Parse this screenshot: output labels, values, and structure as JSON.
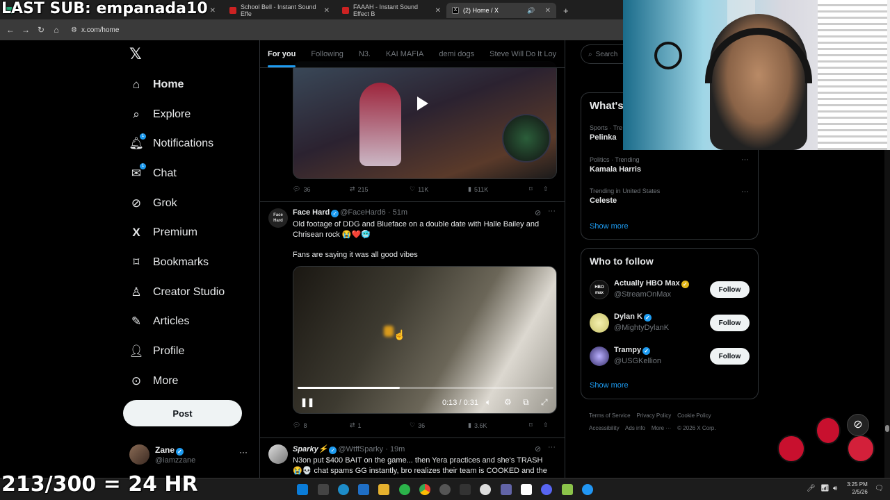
{
  "browser": {
    "tabs": [
      {
        "label": "",
        "active": false
      },
      {
        "label": "School Bell - Instant Sound Effe",
        "active": false
      },
      {
        "label": "FAAAH - Instant Sound Effect B",
        "active": false
      },
      {
        "label": "(2) Home / X",
        "active": true
      }
    ],
    "url": "x.com/home"
  },
  "overlay": {
    "top_banner": "LAST SUB: empanada10",
    "bottom_banner": "213/300 = 24 HR"
  },
  "sidebar": {
    "items": [
      {
        "label": "Home",
        "icon": "home-icon"
      },
      {
        "label": "Explore",
        "icon": "search-icon"
      },
      {
        "label": "Notifications",
        "icon": "bell-icon",
        "badge": "1"
      },
      {
        "label": "Chat",
        "icon": "mail-icon",
        "badge": "1"
      },
      {
        "label": "Grok",
        "icon": "grok-icon"
      },
      {
        "label": "Premium",
        "icon": "x-logo-icon"
      },
      {
        "label": "Bookmarks",
        "icon": "bookmark-icon"
      },
      {
        "label": "Creator Studio",
        "icon": "creator-icon"
      },
      {
        "label": "Articles",
        "icon": "article-icon"
      },
      {
        "label": "Profile",
        "icon": "person-icon"
      },
      {
        "label": "More",
        "icon": "more-circle-icon"
      }
    ],
    "post_label": "Post",
    "account": {
      "name": "Zane",
      "handle": "@iamzzane",
      "more": "···"
    }
  },
  "feed": {
    "tabs": [
      "For you",
      "Following",
      "N3.",
      "KAI MAFIA",
      "demi dogs",
      "Steve Will Do It Loy"
    ],
    "tweet0": {
      "actions": {
        "replies": "36",
        "reposts": "215",
        "likes": "11K",
        "views": "511K"
      }
    },
    "tweet1": {
      "name": "Face Hard",
      "handle": "@FaceHard6",
      "time": "51m",
      "avatar_text": "Face Hard",
      "text1": "Old footage of DDG and Blueface on a double date with Halle Bailey and Chrisean rock 😭❤️🥶",
      "text2": "Fans are saying it was all good vibes",
      "video": {
        "time": "0:13 / 0:31",
        "progress": 0.4
      },
      "actions": {
        "replies": "8",
        "reposts": "1",
        "likes": "36",
        "views": "3.6K"
      }
    },
    "tweet2": {
      "name": "Sparky⚡",
      "handle": "@WtffSparky",
      "time": "19m",
      "text": "N3on put $400 BAIT on the game... then Yera practices and she's TRASH 😭💀 chat spams GG instantly, bro realizes their team is COOKED and the"
    }
  },
  "right": {
    "search_placeholder": "Search",
    "trends_title": "What's",
    "trends": [
      {
        "sub": "Sports · Tre",
        "name": "Pelinka"
      },
      {
        "sub": "Politics · Trending",
        "name": "Kamala Harris"
      },
      {
        "sub": "Trending in United States",
        "name": "Celeste"
      }
    ],
    "trends_more": "Show more",
    "who_title": "Who to follow",
    "who": [
      {
        "name": "Actually HBO Max",
        "handle": "@StreamOnMax",
        "avatar": "HBO max",
        "badge": "gold"
      },
      {
        "name": "Dylan K",
        "handle": "@MightyDylanK",
        "avatar": "",
        "badge": "blue"
      },
      {
        "name": "Trampy",
        "handle": "@USGKellion",
        "avatar": "",
        "badge": "blue"
      }
    ],
    "follow_label": "Follow",
    "who_more": "Show more",
    "footer": [
      "Terms of Service",
      "Privacy Policy",
      "Cookie Policy",
      "Accessibility",
      "Ads info",
      "More ···",
      "© 2026 X Corp."
    ]
  },
  "taskbar": {
    "time": "3:25 PM",
    "date": "2/5/26"
  },
  "colors": {
    "accent": "#1d9bf0",
    "bg": "#000000",
    "border": "#2f3336"
  }
}
